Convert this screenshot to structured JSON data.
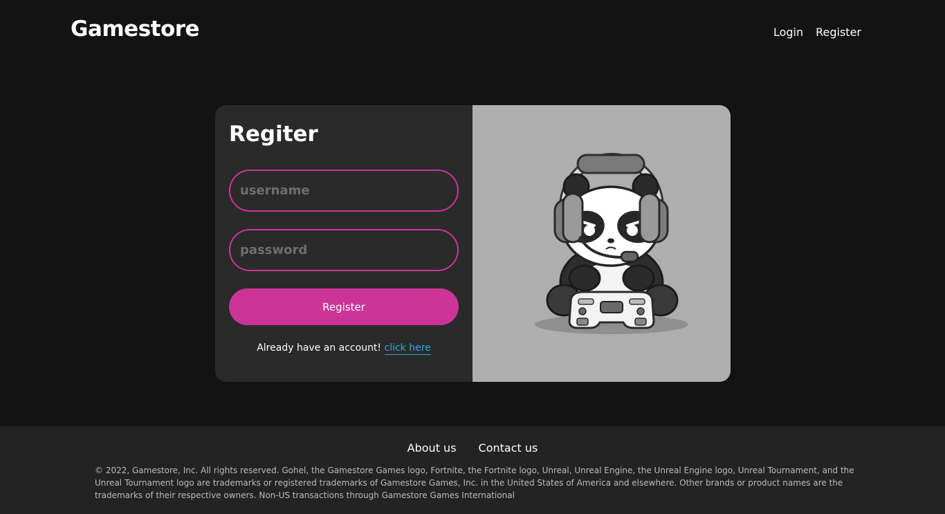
{
  "header": {
    "logo": "Gamestore",
    "nav": {
      "login": "Login",
      "register": "Register"
    }
  },
  "form": {
    "title": "Regiter",
    "username_placeholder": "username",
    "password_placeholder": "password",
    "submit_label": "Register",
    "already_text": "Already have an account!",
    "login_link": "click here"
  },
  "illustration": {
    "icon": "gaming-panda-illustration"
  },
  "footer": {
    "links": {
      "about": "About us",
      "contact": "Contact us"
    },
    "legal": "© 2022, Gamestore, Inc. All rights reserved. Gohel, the Gamestore Games logo, Fortnite, the Fortnite logo, Unreal, Unreal Engine, the Unreal Engine logo, Unreal Tournament, and the Unreal Tournament logo are trademarks or registered trademarks of Gamestore Games, Inc. in the United States of America and elsewhere. Other brands or product names are the trademarks of their respective owners. Non-US transactions through Gamestore Games International"
  },
  "colors": {
    "background": "#131313",
    "card_dark": "#2a2a2b",
    "accent": "#cc3597",
    "link": "#2aa7e6",
    "footer": "#232323"
  }
}
